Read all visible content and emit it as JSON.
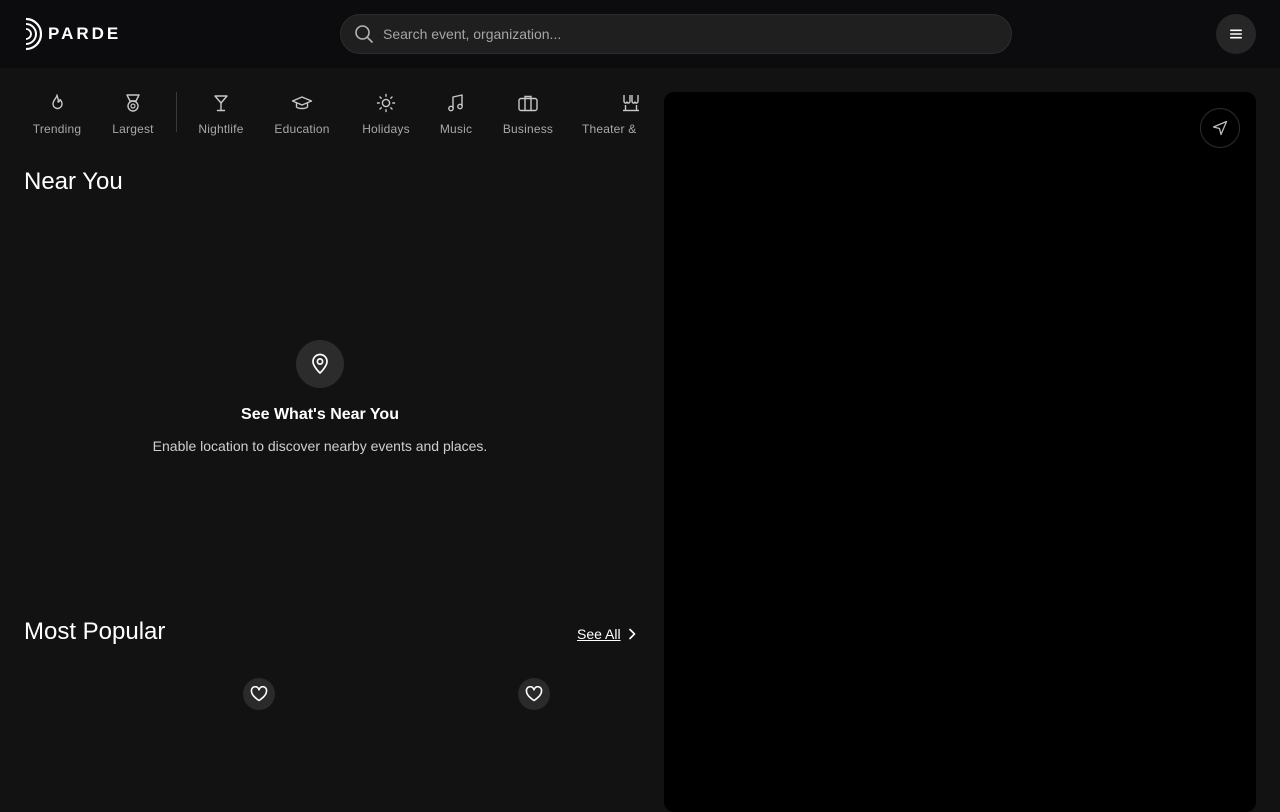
{
  "header": {
    "logo_text": "PARDE",
    "search_placeholder": "Search event, organization..."
  },
  "categories": [
    {
      "label": "Trending",
      "icon": "flame-icon"
    },
    {
      "label": "Largest",
      "icon": "medal-icon"
    },
    {
      "label": "Nightlife",
      "icon": "cocktail-icon"
    },
    {
      "label": "Education",
      "icon": "graduation-cap-icon"
    },
    {
      "label": "Holidays",
      "icon": "sun-icon"
    },
    {
      "label": "Music",
      "icon": "music-note-icon"
    },
    {
      "label": "Business",
      "icon": "briefcase-icon"
    },
    {
      "label": "Theater &",
      "icon": "theater-icon"
    }
  ],
  "near_you": {
    "title": "Near You",
    "empty_title": "See What's Near You",
    "empty_desc": "Enable location to discover nearby events and places."
  },
  "most_popular": {
    "title": "Most Popular",
    "see_all": "See All"
  },
  "colors": {
    "background": "#121212",
    "header": "#0c0b0e",
    "map": "#000000"
  }
}
